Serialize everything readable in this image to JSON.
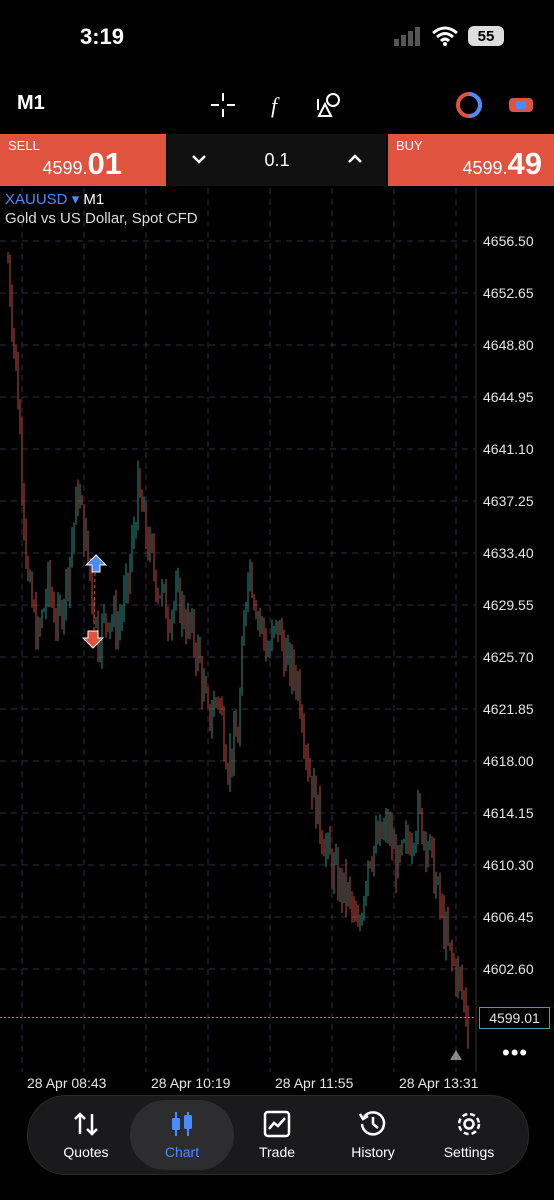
{
  "status": {
    "time": "3:19",
    "battery": "55"
  },
  "toolbar": {
    "timeframe": "M1"
  },
  "trade": {
    "sell_label": "SELL",
    "sell_small": "4599.",
    "sell_big": "01",
    "buy_label": "BUY",
    "buy_small": "4599.",
    "buy_big": "49",
    "volume": "0.1"
  },
  "chart": {
    "symbol": "XAUUSD",
    "symbol_arrow": "▾",
    "timeframe": "M1",
    "description": "Gold vs US Dollar, Spot CFD",
    "price_ticks": [
      "4656.50",
      "4652.65",
      "4648.80",
      "4644.95",
      "4641.10",
      "4637.25",
      "4633.40",
      "4629.55",
      "4625.70",
      "4621.85",
      "4618.00",
      "4614.15",
      "4610.30",
      "4606.45",
      "4602.60"
    ],
    "current_price": "4599.01",
    "time_ticks": [
      "28 Apr 08:43",
      "28 Apr 10:19",
      "28 Apr 11:55",
      "28 Apr 13:31"
    ],
    "more": "•••"
  },
  "nav": {
    "quotes": "Quotes",
    "chart": "Chart",
    "trade": "Trade",
    "history": "History",
    "settings": "Settings"
  },
  "chart_data": {
    "type": "line",
    "x": [
      0,
      10,
      20,
      30,
      40,
      50,
      60,
      70,
      80,
      90,
      100,
      110,
      120,
      130,
      140,
      150,
      160,
      170,
      180,
      190,
      200,
      210,
      220,
      230,
      240,
      250,
      260,
      270,
      280,
      290,
      300,
      310,
      320,
      330,
      340,
      350,
      360,
      370,
      380,
      390,
      400,
      410,
      420,
      430,
      440,
      450,
      460
    ],
    "y": [
      4655,
      4645,
      4631,
      4627,
      4631,
      4628,
      4632,
      4638,
      4633,
      4627,
      4629,
      4628,
      4631,
      4638,
      4634,
      4631,
      4629,
      4630,
      4628,
      4626,
      4621,
      4623,
      4618,
      4620,
      4633,
      4629,
      4626,
      4628,
      4625,
      4624,
      4618,
      4614,
      4611,
      4609,
      4608,
      4605,
      4611,
      4612,
      4613,
      4610,
      4612,
      4614,
      4612,
      4608,
      4604,
      4602,
      4599
    ],
    "ylim": [
      4597,
      4660
    ],
    "grid": true,
    "colors": {
      "up": "#2a8f86",
      "down": "#c4473d",
      "grid": "#2a3140",
      "bid_line": "#3ba3a3"
    }
  }
}
